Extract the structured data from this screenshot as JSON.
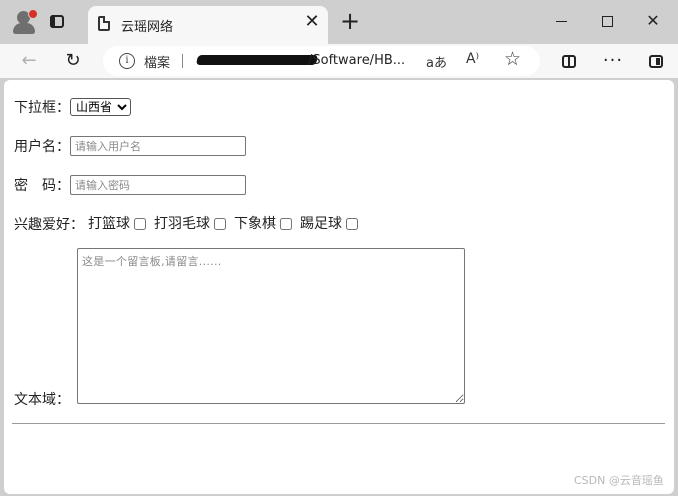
{
  "browser": {
    "tab_title": "云瑶网络",
    "tab_close": "✕",
    "new_tab": "+",
    "address": {
      "site_label": "檔案",
      "url_visible": "/Software/HB...",
      "read_aloud_icon_text": "aあ",
      "immersive_icon_text": "A⁾"
    },
    "more_label": "···"
  },
  "form": {
    "select": {
      "label": "下拉框：",
      "selected": "山西省"
    },
    "username": {
      "label": "用户名：",
      "placeholder": "请输入用户名"
    },
    "password": {
      "label": "密　码：",
      "placeholder": "请输入密码"
    },
    "hobbies": {
      "label": "兴趣爱好：",
      "options": [
        "打篮球",
        "打羽毛球",
        "下象棋",
        "踢足球"
      ]
    },
    "textarea": {
      "label": "文本域：",
      "placeholder": "这是一个留言板,请留言......"
    }
  },
  "watermark": "CSDN @云音瑶鱼"
}
